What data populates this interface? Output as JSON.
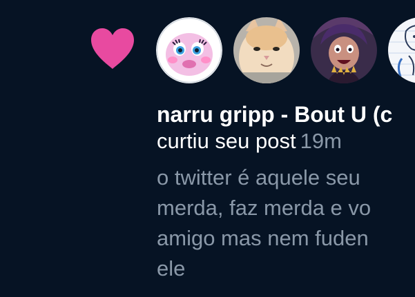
{
  "notification": {
    "type_icon": "heart-icon",
    "accent_color": "#e84aa0",
    "author": "narru gripp - Bout U (c",
    "action": "curtiu seu post",
    "time": "19m",
    "snippet_lines": [
      "o twitter é aquele seu",
      "merda, faz merda e vo",
      "amigo mas nem fuden",
      "ele"
    ],
    "avatars": [
      {
        "icon": "pink-blob-face-avatar"
      },
      {
        "icon": "cat-photo-avatar"
      },
      {
        "icon": "cartoon-witch-avatar"
      },
      {
        "icon": "sketch-drawing-avatar"
      }
    ]
  }
}
